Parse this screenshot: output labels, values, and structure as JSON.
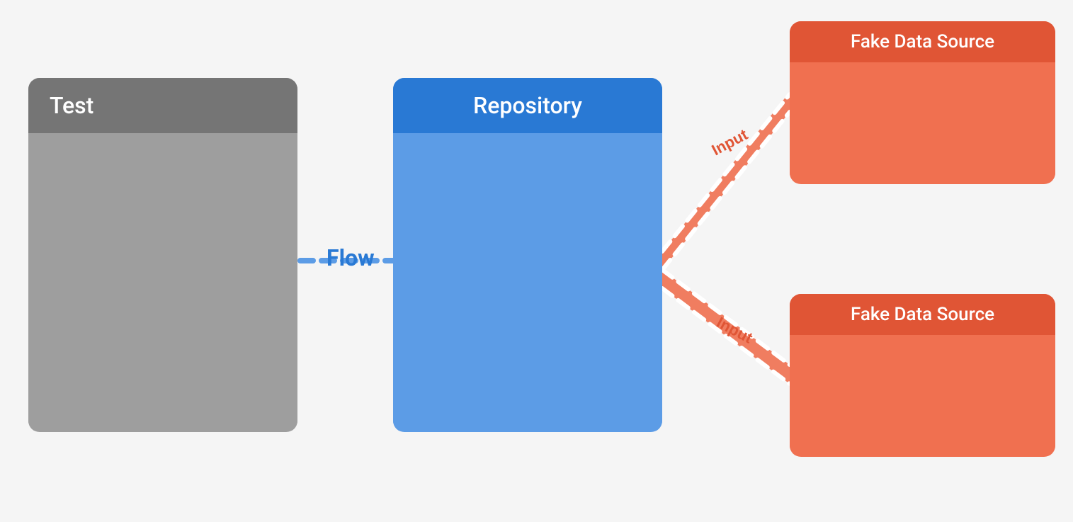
{
  "nodes": {
    "test": {
      "title": "Test"
    },
    "repository": {
      "title": "Repository"
    },
    "fakeDataSource1": {
      "title": "Fake Data Source",
      "inputLabel": "Input"
    },
    "fakeDataSource2": {
      "title": "Fake Data Source",
      "inputLabel": "Input"
    }
  },
  "connections": {
    "flowLabel": "Flow"
  },
  "colors": {
    "testHeader": "#757575",
    "testBody": "#9e9e9e",
    "repoHeader": "#2979d4",
    "repoBody": "#5c9ce6",
    "fdsHeader": "#e05535",
    "fdsBody": "#f07050",
    "flowArrow": "#2979d4",
    "inputArrow": "#e87050"
  }
}
